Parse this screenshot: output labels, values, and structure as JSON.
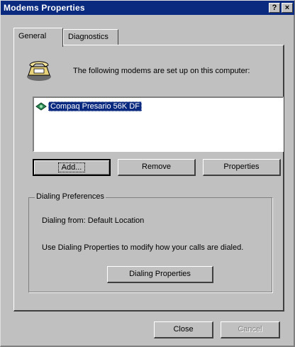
{
  "window": {
    "title": "Modems Properties",
    "help_button": "?",
    "close_button": "×"
  },
  "tabs": [
    {
      "label": "General",
      "active": true
    },
    {
      "label": "Diagnostics",
      "active": false
    }
  ],
  "general": {
    "intro_text": "The following modems are set up on this computer:",
    "modems": [
      {
        "name": "Compaq Presario 56K DF",
        "selected": true
      }
    ],
    "buttons": {
      "add": "Add...",
      "remove": "Remove",
      "properties": "Properties"
    },
    "dialing": {
      "group_label": "Dialing Preferences",
      "dialing_from": "Dialing from:  Default Location",
      "help_text": "Use Dialing Properties to modify how your calls are dialed.",
      "dialing_properties_button": "Dialing Properties"
    }
  },
  "footer": {
    "close_button": "Close",
    "cancel_button": "Cancel",
    "cancel_enabled": false
  }
}
